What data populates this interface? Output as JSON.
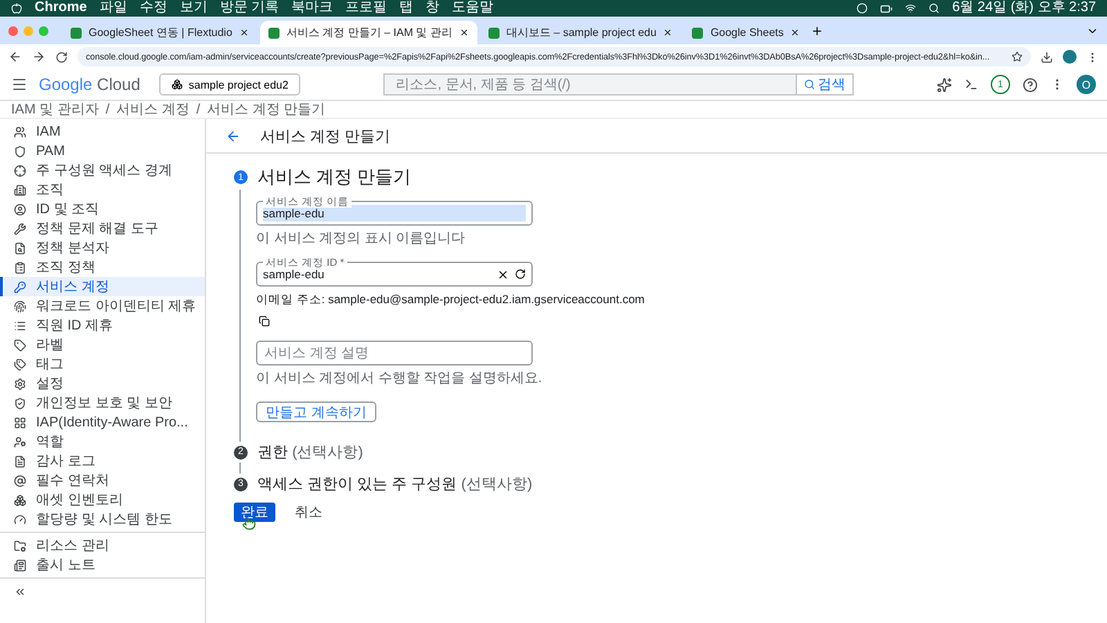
{
  "menu_bar": {
    "app": "Chrome",
    "items": [
      "파일",
      "수정",
      "보기",
      "방문 기록",
      "북마크",
      "프로필",
      "탭",
      "창",
      "도움말"
    ],
    "clock": "6월 24일 (화) 오후 2:37"
  },
  "tabs": [
    {
      "title": "GoogleSheet 연동 | Flextudio",
      "selected": false
    },
    {
      "title": "서비스 계정 만들기 – IAM 및 관리",
      "selected": true
    },
    {
      "title": "대시보드 – sample project edu",
      "selected": false
    },
    {
      "title": "Google Sheets",
      "selected": false
    }
  ],
  "address_bar": {
    "url": "console.cloud.google.com/iam-admin/serviceaccounts/create?previousPage=%2Fapis%2Fapi%2Fsheets.googleapis.com%2Fcredentials%3Fhl%3Dko%26inv%3D1%26invt%3DAb0BsA%26project%3Dsample-project-edu2&hl=ko&in..."
  },
  "header": {
    "logo_google": "Google",
    "logo_cloud": "Cloud",
    "project": "sample project edu2",
    "search_placeholder": "리소스, 문서, 제품 등 검색(/)",
    "search_button": "검색",
    "notification_count": "1",
    "avatar": "O"
  },
  "breadcrumb": [
    "IAM 및 관리자",
    "서비스 계정",
    "서비스 계정 만들기"
  ],
  "breadcrumb_separator": "/",
  "sidebar": {
    "items": [
      {
        "label": "IAM",
        "selected": false
      },
      {
        "label": "PAM",
        "selected": false
      },
      {
        "label": "주 구성원 액세스 경계",
        "selected": false
      },
      {
        "label": "조직",
        "selected": false
      },
      {
        "label": "ID 및 조직",
        "selected": false
      },
      {
        "label": "정책 문제 해결 도구",
        "selected": false
      },
      {
        "label": "정책 분석자",
        "selected": false
      },
      {
        "label": "조직 정책",
        "selected": false
      },
      {
        "label": "서비스 계정",
        "selected": true
      },
      {
        "label": "워크로드 아이덴티티 제휴",
        "selected": false
      },
      {
        "label": "직원 ID 제휴",
        "selected": false
      },
      {
        "label": "라벨",
        "selected": false
      },
      {
        "label": "태그",
        "selected": false
      },
      {
        "label": "설정",
        "selected": false
      },
      {
        "label": "개인정보 보호 및 보안",
        "selected": false
      },
      {
        "label": "IAP(Identity-Aware Pro...",
        "selected": false
      },
      {
        "label": "역할",
        "selected": false
      },
      {
        "label": "감사 로그",
        "selected": false
      },
      {
        "label": "필수 연락처",
        "selected": false
      },
      {
        "label": "애셋 인벤토리",
        "selected": false
      },
      {
        "label": "할당량 및 시스템 한도",
        "selected": false
      }
    ],
    "footer_items": [
      "리소스 관리",
      "출시 노트"
    ]
  },
  "page_title": "서비스 계정 만들기",
  "steps": [
    {
      "number": "1",
      "title": "서비스 계정 만들기",
      "active": true
    },
    {
      "number": "2",
      "title": "권한",
      "suffix": "(선택사항)",
      "active": false
    },
    {
      "number": "3",
      "title": "액세스 권한이 있는 주 구성원",
      "suffix": "(선택사항)",
      "active": false
    }
  ],
  "form": {
    "name_label": "서비스 계정 이름",
    "name_value": "sample-edu",
    "name_hint": "이 서비스 계정의 표시 이름입니다",
    "id_label": "서비스 계정 ID *",
    "id_value": "sample-edu",
    "email": "이메일 주소: sample-edu@sample-project-edu2.iam.gserviceaccount.com",
    "description_placeholder": "서비스 계정 설명",
    "description_hint": "이 서비스 계정에서 수행할 작업을 설명하세요.",
    "continue_button": "만들고 계속하기"
  },
  "actions": {
    "done": "완료",
    "cancel": "취소"
  }
}
